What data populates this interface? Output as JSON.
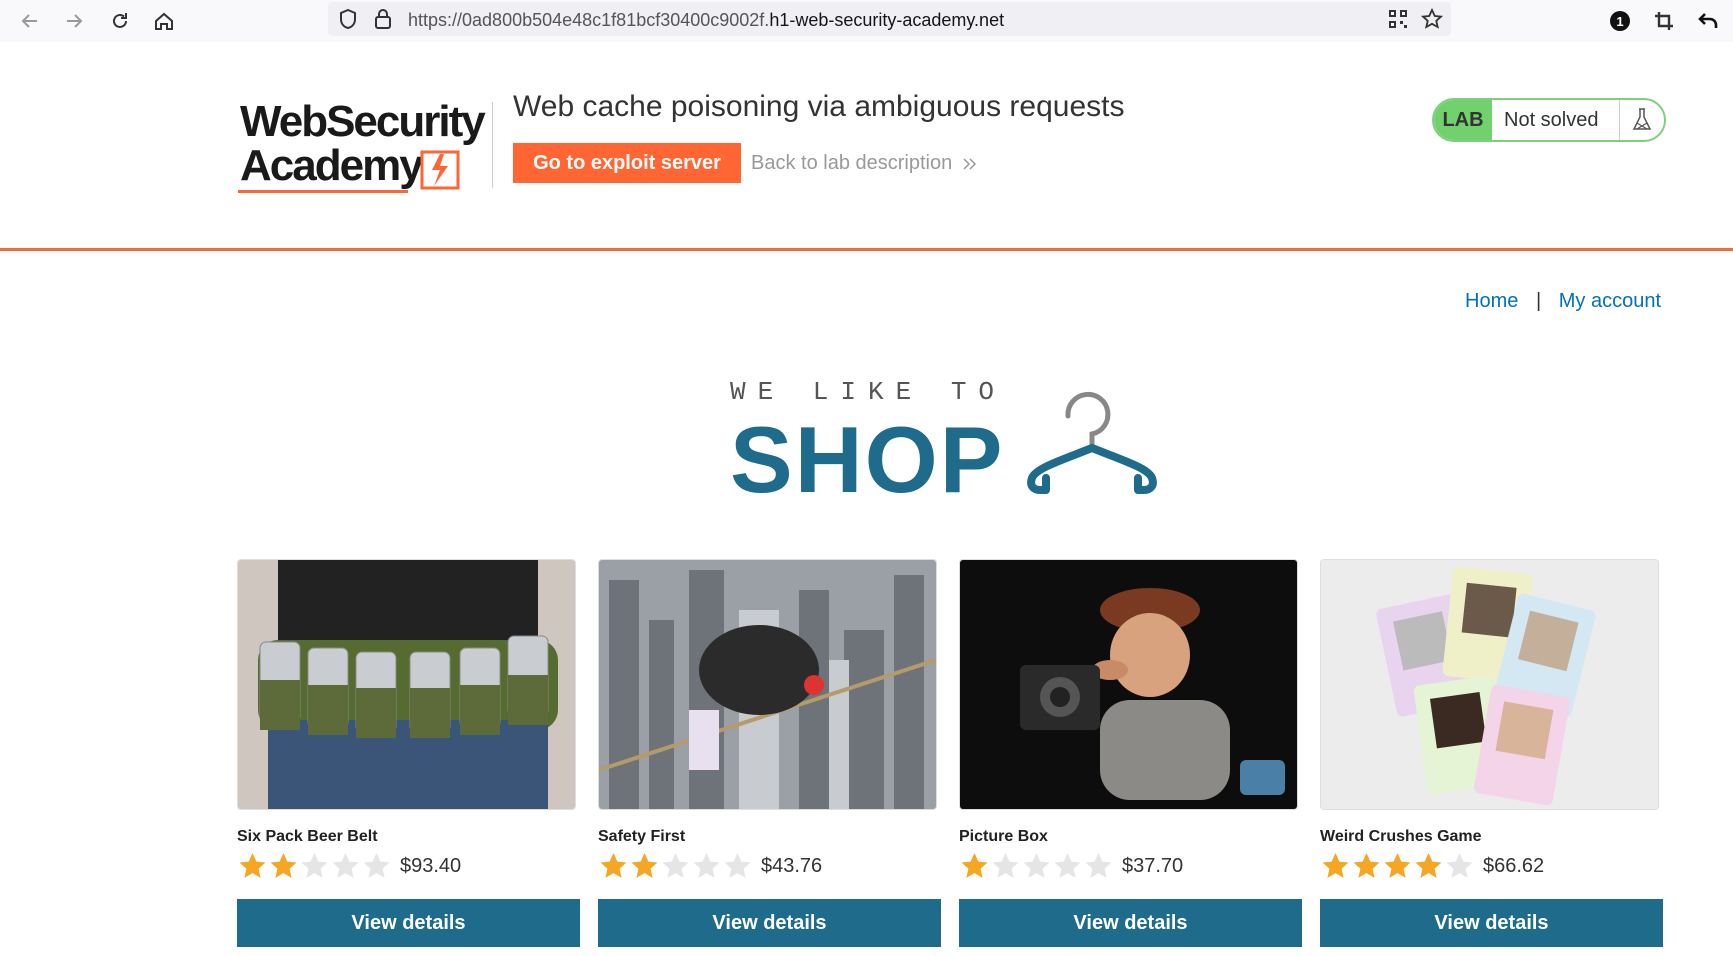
{
  "browser": {
    "url_prefix": "https://0ad800b504e48c1f81bcf30400c9002f.",
    "url_domain": "h1-web-security-academy.net",
    "extension_badge": "1"
  },
  "header": {
    "logo_line1": "WebSecurity",
    "logo_line2": "Academy",
    "lab_title": "Web cache poisoning via ambiguous requests",
    "exploit_button": "Go to exploit server",
    "back_link": "Back to lab description",
    "lab_badge_label": "LAB",
    "lab_status": "Not solved"
  },
  "nav": {
    "home": "Home",
    "separator": "|",
    "my_account": "My account"
  },
  "banner": {
    "top_text": "WE LIKE TO",
    "big_text": "SHOP"
  },
  "products": [
    {
      "name": "Six Pack Beer Belt",
      "rating": 2,
      "price": "$93.40",
      "button": "View details"
    },
    {
      "name": "Safety First",
      "rating": 2,
      "price": "$43.76",
      "button": "View details"
    },
    {
      "name": "Picture Box",
      "rating": 1,
      "price": "$37.70",
      "button": "View details"
    },
    {
      "name": "Weird Crushes Game",
      "rating": 4,
      "price": "$66.62",
      "button": "View details"
    }
  ],
  "colors": {
    "accent_orange": "#ff6633",
    "brand_blue": "#1e6b8c",
    "link_blue": "#0071bc",
    "lab_green": "#70d16d",
    "star_filled": "#f5a623",
    "star_empty": "#e5e5e5"
  }
}
